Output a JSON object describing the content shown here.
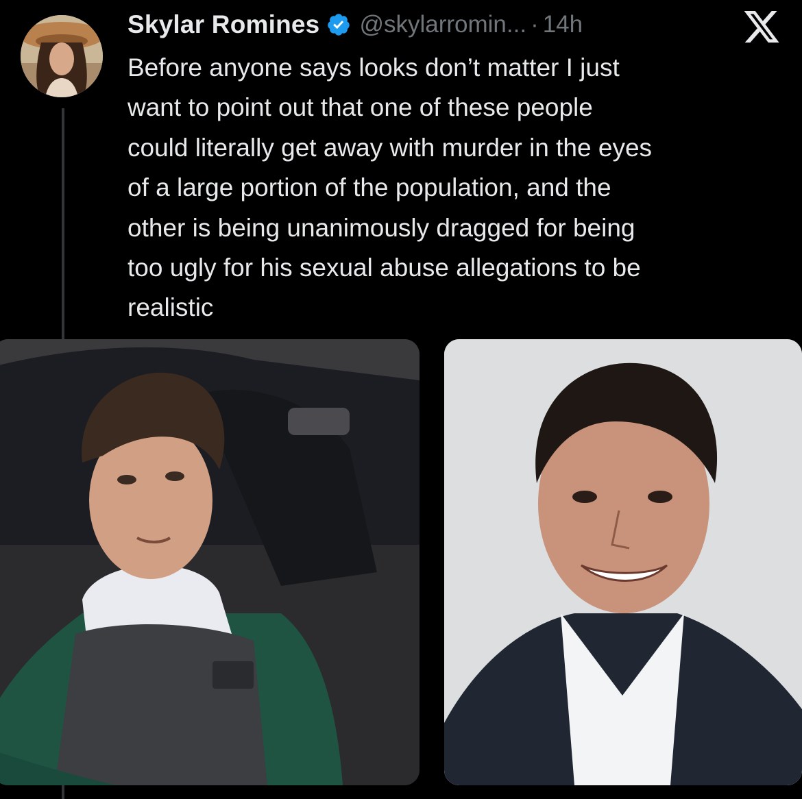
{
  "tweet": {
    "author": {
      "display_name": "Skylar Romines",
      "handle": "@skylarromin...",
      "verified": true
    },
    "separator": "·",
    "timestamp": "14h",
    "text": "Before anyone says looks don’t matter I just\nwant to point out that one of these people\ncould literally get away with murder in the eyes\nof a large portion of the population, and the\nother is being unanimously dragged for being\ntoo ugly for his sexual abuse allegations to be\nrealistic",
    "media": [
      {
        "icon": "photo-icon"
      },
      {
        "icon": "photo-icon"
      }
    ]
  },
  "brand": {
    "icon": "x-logo-icon"
  },
  "colors": {
    "background": "#000000",
    "text_primary": "#e7e9ea",
    "text_secondary": "#71767b",
    "verified_blue": "#1d9bf0",
    "thread_line": "#333639"
  }
}
